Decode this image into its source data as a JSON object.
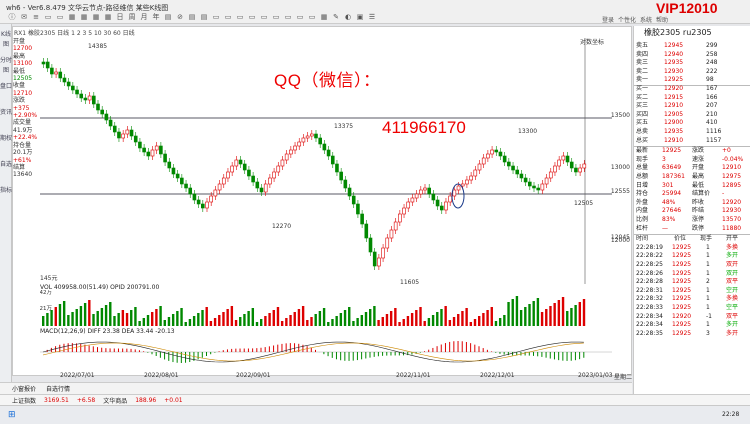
{
  "window": {
    "title": "wh6 - Ver6.8.479  文华云节点-路径维信  某些K线图",
    "vip": "VIP12010",
    "menu": [
      "登录",
      "个性化",
      "系统",
      "帮助"
    ]
  },
  "toolbar": {
    "icons": [
      "ⓘ",
      "✉",
      "≡",
      "▭",
      "▭",
      "▦",
      "▦",
      "▦",
      "▦",
      "日",
      "周",
      "月",
      "年",
      "▤",
      "⊘",
      "▤",
      "▤",
      "▭",
      "▭",
      "▭",
      "▭",
      "▭",
      "▭",
      "▭",
      "▭",
      "▭",
      "▦",
      "✎",
      "◐",
      "▣",
      "☰"
    ]
  },
  "sidebar": {
    "items": [
      "K线图",
      "分时图",
      "盘口",
      "资讯",
      "期权",
      "自选",
      "指标"
    ]
  },
  "chart": {
    "header": "RX1 橡胶2305  日线  1 2 3 5 10 30 60  日线",
    "info_lines": [
      {
        "t": "开盘",
        "c": "blk"
      },
      {
        "t": "12700",
        "c": "r"
      },
      {
        "t": "最高",
        "c": "blk"
      },
      {
        "t": "13100",
        "c": "r"
      },
      {
        "t": "最低",
        "c": "blk"
      },
      {
        "t": "12505",
        "c": "g"
      },
      {
        "t": "收盘",
        "c": "blk"
      },
      {
        "t": "12710",
        "c": "r"
      },
      {
        "t": "涨跌",
        "c": "blk"
      },
      {
        "t": "+375",
        "c": "r"
      },
      {
        "t": "+2.90%",
        "c": "r"
      },
      {
        "t": "成交量",
        "c": "blk"
      },
      {
        "t": "41.9万",
        "c": "blk"
      },
      {
        "t": "+22.4%",
        "c": "r"
      },
      {
        "t": "持仓量",
        "c": "blk"
      },
      {
        "t": "20.1万",
        "c": "blk"
      },
      {
        "t": "+61%",
        "c": "r"
      },
      {
        "t": "结算",
        "c": "blk"
      },
      {
        "t": "13640",
        "c": "blk"
      }
    ],
    "annotations": {
      "hi": "14385",
      "mid1": "13375",
      "mid2": "13300",
      "lo1": "12270",
      "lo2": "11605",
      "lo3": "12505",
      "rlabel": "对数坐标",
      "bottom_left": "145元"
    },
    "yticks": [
      {
        "v": "13500",
        "y": 78
      },
      {
        "v": "13000",
        "y": 130
      },
      {
        "v": "12555",
        "y": 154
      },
      {
        "v": "12045",
        "y": 200
      },
      {
        "v": "12000",
        "y": 203
      }
    ],
    "volume_label": "VOL  409958.00(51.49)  OPID 200791.00",
    "vol_ticks": [
      "42万",
      "21万"
    ],
    "macd_label": "MACD(12,26,9)  DIFF 23.38  DEA 33.44  -20.13",
    "xlabels": [
      {
        "t": "2022/07/01",
        "x": 20
      },
      {
        "t": "2022/08/01",
        "x": 104
      },
      {
        "t": "2022/09/01",
        "x": 196
      },
      {
        "t": "2022/11/01",
        "x": 356
      },
      {
        "t": "2022/12/01",
        "x": 440
      },
      {
        "t": "2023/01/03",
        "x": 538
      },
      {
        "t": "星期二",
        "x": 574
      }
    ]
  },
  "watermark": {
    "line1": "QQ（微信）：",
    "line2": "411966170"
  },
  "bottom": {
    "tabs": [
      "小窗报价",
      "自选行情"
    ]
  },
  "status": {
    "index": "上证指数",
    "index_val": "3169.51",
    "index_chg": "+6.58",
    "sec": "文华商品",
    "sec_val": "188.96",
    "sec_chg": "+0.01"
  },
  "quote": {
    "title": "橡胶2305  ru2305",
    "asks": [
      [
        "卖五",
        "12945",
        "299"
      ],
      [
        "卖四",
        "12940",
        "258"
      ],
      [
        "卖三",
        "12935",
        "248"
      ],
      [
        "卖二",
        "12930",
        "222"
      ],
      [
        "卖一",
        "12925",
        "98"
      ]
    ],
    "bids": [
      [
        "买一",
        "12920",
        "167"
      ],
      [
        "买二",
        "12915",
        "166"
      ],
      [
        "买三",
        "12910",
        "207"
      ],
      [
        "买四",
        "12905",
        "210"
      ],
      [
        "买五",
        "12900",
        "410"
      ]
    ],
    "sum": [
      [
        "总卖",
        "12935",
        "1116"
      ],
      [
        "总买",
        "12910",
        "1157"
      ]
    ],
    "stats": [
      [
        "最新",
        "12925",
        "涨跌",
        "+0"
      ],
      [
        "现手",
        "3",
        "速涨",
        "-0.04%"
      ],
      [
        "总量",
        "63649",
        "开盘",
        "12910"
      ],
      [
        "总额",
        "187361",
        "最高",
        "12975"
      ],
      [
        "日增",
        "301",
        "最低",
        "12895"
      ],
      [
        "持仓",
        "25994",
        "结算价",
        "-"
      ],
      [
        "外盘",
        "48%",
        "昨收",
        "12920"
      ],
      [
        "内盘",
        "27646",
        "昨结",
        "12930"
      ],
      [
        "比例",
        "83%",
        "涨停",
        "13570"
      ],
      [
        "杠杆",
        "—",
        "跌停",
        "11880"
      ]
    ],
    "ticks_head": [
      "时间",
      "价位",
      "现手",
      "开平"
    ],
    "ticks": [
      [
        "22:28:19",
        "12925",
        "1",
        "多换"
      ],
      [
        "22:28:22",
        "12925",
        "1",
        "多开"
      ],
      [
        "22:28:25",
        "12925",
        "1",
        "双开"
      ],
      [
        "22:28:26",
        "12925",
        "1",
        "双开"
      ],
      [
        "22:28:28",
        "12925",
        "2",
        "双平"
      ],
      [
        "22:28:31",
        "12925",
        "1",
        "空开"
      ],
      [
        "22:28:32",
        "12925",
        "1",
        "多换"
      ],
      [
        "22:28:33",
        "12925",
        "1",
        "空平"
      ],
      [
        "22:28:34",
        "12920",
        "-1",
        "双平"
      ],
      [
        "22:28:34",
        "12925",
        "1",
        "多开"
      ],
      [
        "22:28:35",
        "12925",
        "3",
        "多开"
      ]
    ]
  },
  "taskbar": {
    "time": "22:28"
  },
  "colors": {
    "up": "#dd0000",
    "down": "#008800",
    "accent": "#dd0000"
  }
}
